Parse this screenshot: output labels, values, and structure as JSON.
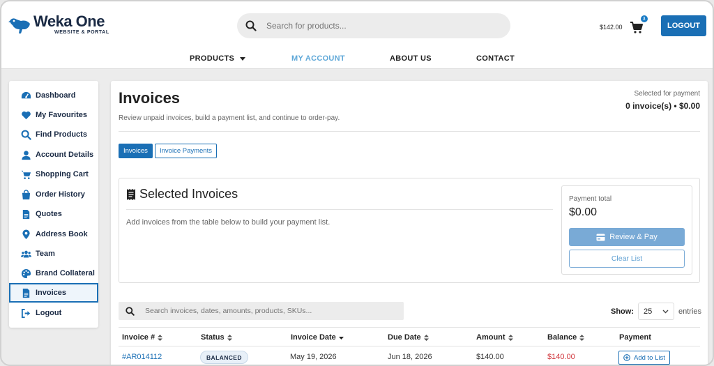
{
  "brand": {
    "name": "Weka One",
    "tagline": "WEBSITE & PORTAL"
  },
  "search": {
    "placeholder": "Search for products..."
  },
  "cart": {
    "total": "$142.00",
    "count": "3"
  },
  "header": {
    "logout_label": "LOGOUT"
  },
  "nav": {
    "products": "PRODUCTS",
    "my_account": "MY ACCOUNT",
    "about": "ABOUT US",
    "contact": "CONTACT"
  },
  "sidebar": {
    "items": [
      {
        "label": "Dashboard"
      },
      {
        "label": "My Favourites"
      },
      {
        "label": "Find Products"
      },
      {
        "label": "Account Details"
      },
      {
        "label": "Shopping Cart"
      },
      {
        "label": "Order History"
      },
      {
        "label": "Quotes"
      },
      {
        "label": "Address Book"
      },
      {
        "label": "Team"
      },
      {
        "label": "Brand Collateral"
      },
      {
        "label": "Invoices"
      },
      {
        "label": "Logout"
      }
    ]
  },
  "page": {
    "title": "Invoices",
    "description": "Review unpaid invoices, build a payment list, and continue to order-pay.",
    "selected_label": "Selected for payment",
    "selected_value": "0 invoice(s) • $0.00"
  },
  "tabs": {
    "invoices": "Invoices",
    "invoice_payments": "Invoice Payments"
  },
  "selected_panel": {
    "title": "Selected Invoices",
    "description": "Add invoices from the table below to build your payment list.",
    "payment_total_label": "Payment total",
    "payment_total": "$0.00",
    "review_label": "Review & Pay",
    "clear_label": "Clear List"
  },
  "table": {
    "search_placeholder": "Search invoices, dates, amounts, products, SKUs...",
    "show_label": "Show:",
    "show_value": "25",
    "entries_label": "entries",
    "columns": [
      "Invoice #",
      "Status",
      "Invoice Date",
      "Due Date",
      "Amount",
      "Balance",
      "Payment"
    ],
    "rows": [
      {
        "invoice": "#AR014112",
        "status": "BALANCED",
        "invoice_date": "May 19, 2026",
        "due_date": "Jun 18, 2026",
        "amount": "$140.00",
        "balance": "$140.00",
        "action": "Add to List"
      }
    ]
  }
}
